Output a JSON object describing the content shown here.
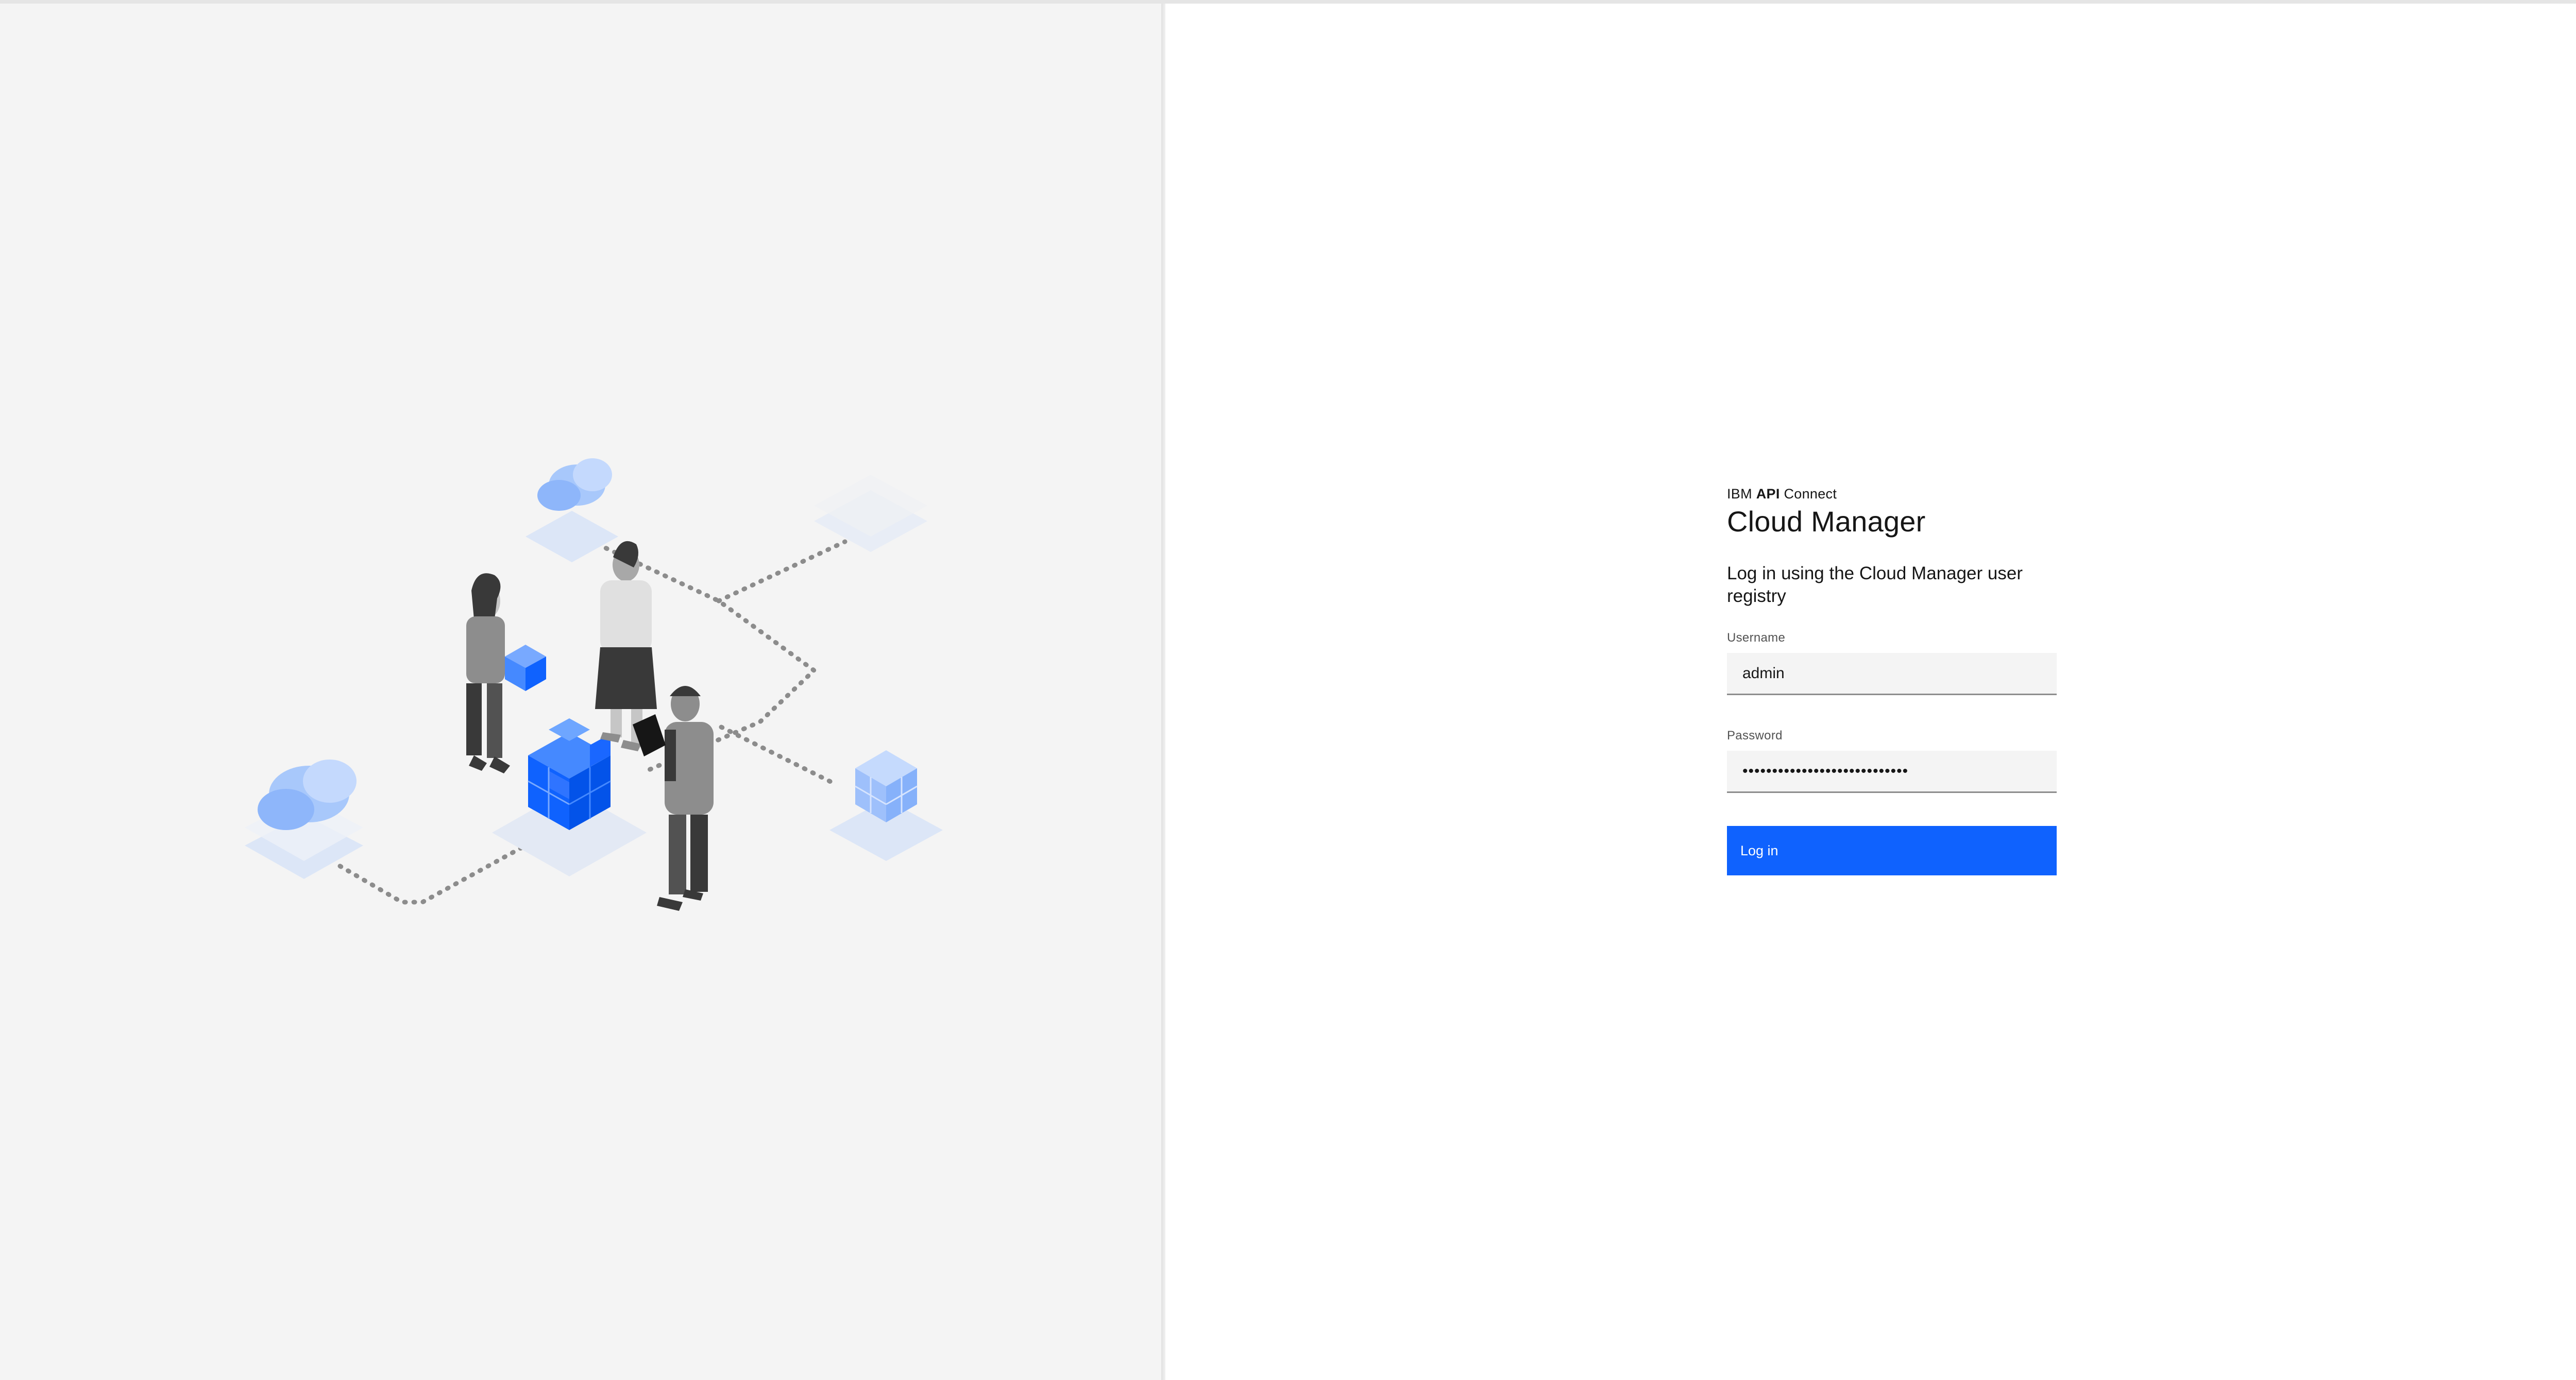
{
  "brand": {
    "prefix": "IBM",
    "emphasis": "API",
    "suffix": "Connect"
  },
  "title": "Cloud Manager",
  "instructions": "Log in using the Cloud Manager user registry",
  "form": {
    "username_label": "Username",
    "username_value": "admin",
    "password_label": "Password",
    "password_value": "abcdefghijklmnopqrstuvwxyzab",
    "login_label": "Log in"
  },
  "colors": {
    "left_background": "#f4f4f4",
    "right_background": "#ffffff",
    "primary_button": "#0f62fe",
    "field_background": "#f4f4f4",
    "illustration_accent": "#0f62fe"
  },
  "illustration": {
    "icons": [
      "cloud-icon",
      "cube-stack-icon",
      "person-icon",
      "tablet-icon",
      "dotted-connection-icon"
    ]
  }
}
